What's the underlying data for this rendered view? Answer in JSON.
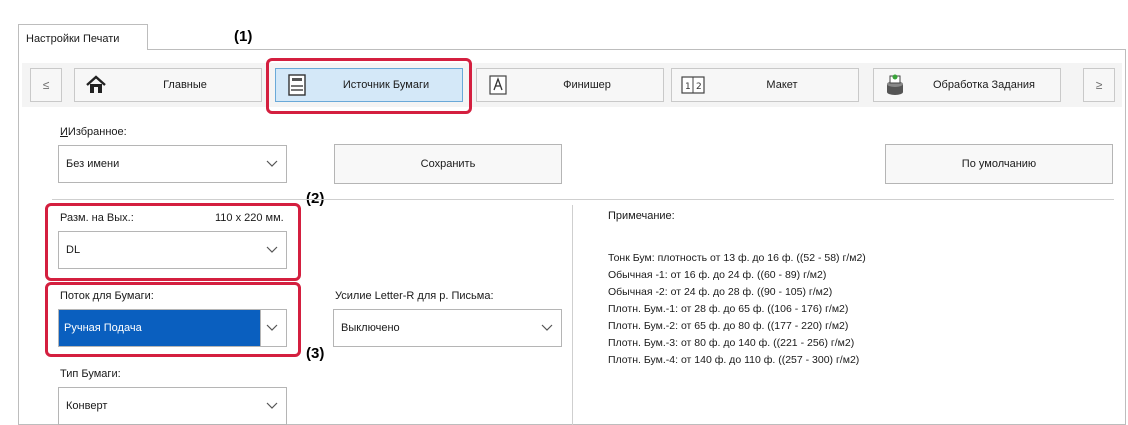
{
  "tab": {
    "label": "Настройки Печати"
  },
  "callouts": {
    "c1": "(1)",
    "c2": "(2)",
    "c3": "(3)"
  },
  "nav": {
    "prev": "≤",
    "next": "≥",
    "items": [
      {
        "label": "Главные",
        "icon": "home-icon"
      },
      {
        "label": "Источник Бумаги",
        "icon": "printer-tray-icon"
      },
      {
        "label": "Финишер",
        "icon": "finisher-icon"
      },
      {
        "label": "Макет",
        "icon": "layout-icon"
      },
      {
        "label": "Обработка Задания",
        "icon": "job-stack-icon"
      }
    ],
    "active_index": 1
  },
  "favorites": {
    "label": "Избранное:",
    "value": "Без имени",
    "save": "Сохранить",
    "default": "По умолчанию"
  },
  "output_size": {
    "label": "Разм. на Вых.:",
    "dimension": "110 x 220 мм.",
    "value": "DL"
  },
  "paper_source": {
    "label": "Поток для Бумаги:",
    "value": "Ручная Подача"
  },
  "letter_r": {
    "label": "Усилие Letter-R для р. Письма:",
    "value": "Выключено"
  },
  "paper_type": {
    "label": "Тип Бумаги:",
    "value": "Конверт"
  },
  "note": {
    "title": "Примечание:",
    "lines": [
      "Тонк Бум: плотность от 13 ф. до 16 ф. ((52 - 58) г/м2)",
      "Обычная -1: от 16 ф. до 24 ф. ((60 - 89) г/м2)",
      "Обычная -2: от 24 ф. до 28 ф. ((90 - 105) г/м2)",
      "Плотн. Бум.-1: от 28 ф. до 65 ф. ((106 - 176) г/м2)",
      "Плотн. Бум.-2: от 65 ф. до 80 ф. ((177 - 220) г/м2)",
      "Плотн. Бум.-3: от 80 ф. до 140 ф. ((221 - 256) г/м2)",
      "Плотн. Бум.-4: от 140 ф. до 110 ф. ((257 - 300) г/м2)"
    ]
  },
  "colors": {
    "highlight": "#d41f3f",
    "selection": "#0a5fbf",
    "active_tab": "#d4e8f8"
  }
}
